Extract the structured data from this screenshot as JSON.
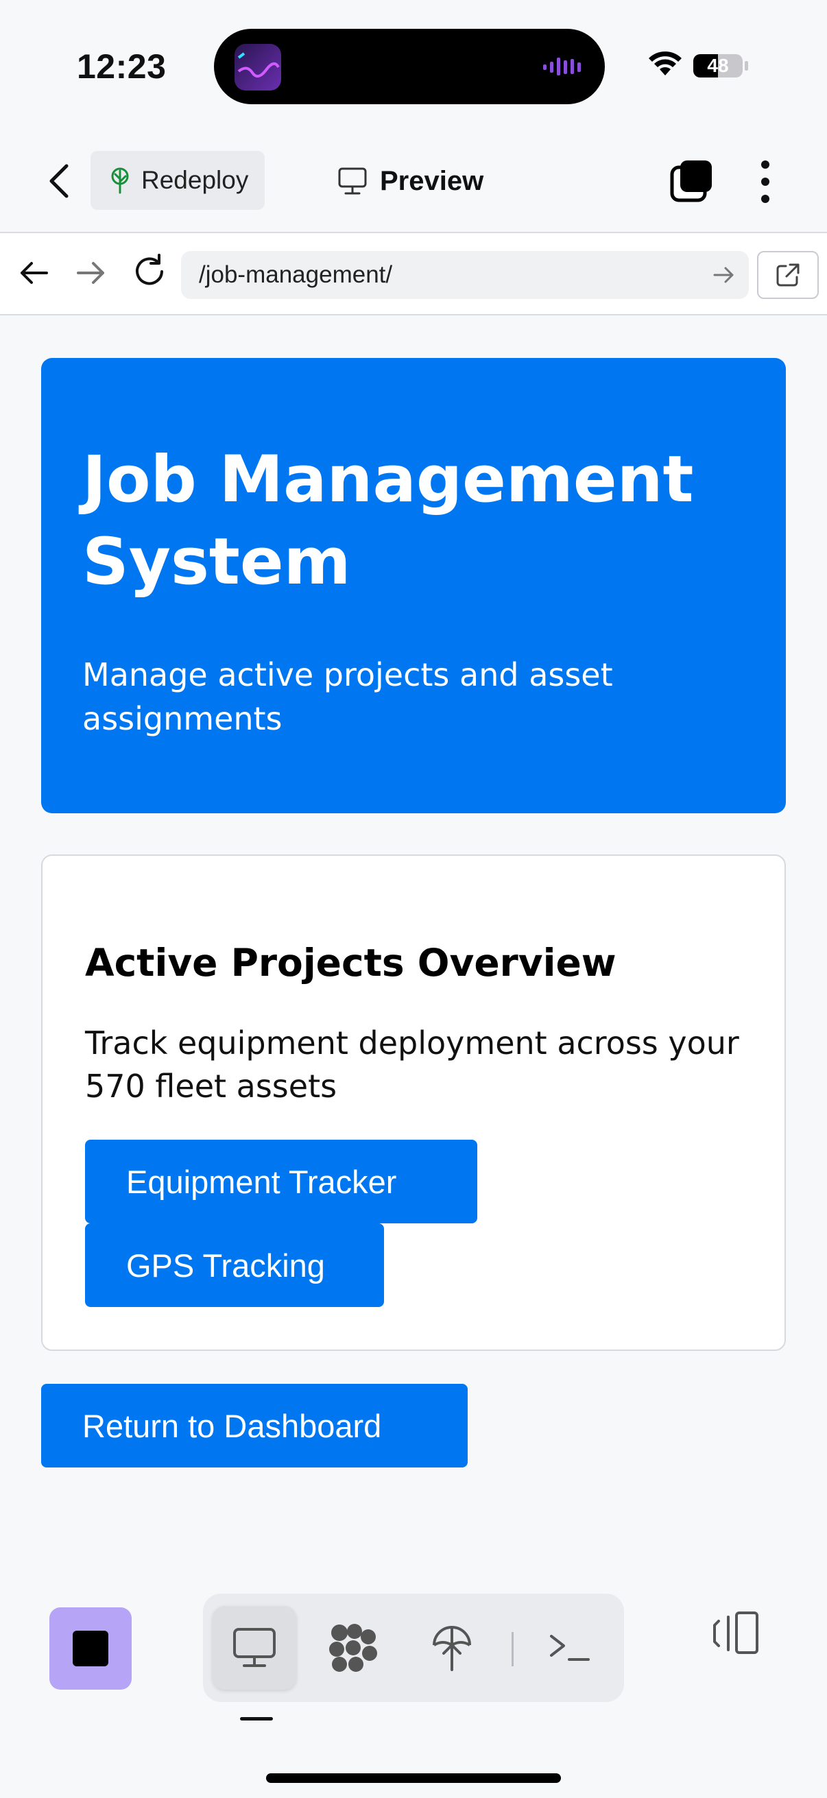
{
  "status_bar": {
    "time": "12:23",
    "battery": "48",
    "icons": [
      "wifi-icon",
      "battery-icon"
    ]
  },
  "app_bar": {
    "redeploy_label": "Redeploy",
    "preview_label": "Preview",
    "icons": [
      "back-chevron-icon",
      "tree-icon",
      "monitor-icon",
      "windows-icon",
      "more-vertical-icon"
    ]
  },
  "browser": {
    "url": "/job-management/",
    "icons": [
      "arrow-left-icon",
      "arrow-right-icon",
      "reload-icon",
      "go-arrow-icon",
      "external-link-icon"
    ]
  },
  "page": {
    "hero": {
      "title": "Job Management System",
      "subtitle": "Manage active projects and asset assignments"
    },
    "card": {
      "title": "Active Projects Overview",
      "text": "Track equipment deployment across your 570 fleet assets",
      "buttons": [
        "Equipment Tracker",
        "GPS Tracking"
      ]
    },
    "return_button": "Return to Dashboard"
  },
  "bottom_bar": {
    "tools": [
      "monitor-icon",
      "nodes-icon",
      "deploy-icon",
      "terminal-icon"
    ],
    "active_tool": "monitor-icon"
  },
  "colors": {
    "primary": "#0077f0",
    "background": "#f7f8fa",
    "stop_button": "#b6a4f7"
  }
}
